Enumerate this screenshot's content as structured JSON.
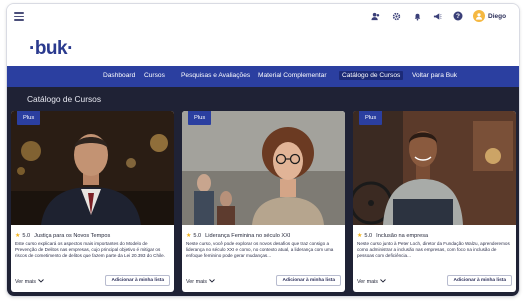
{
  "topbar": {
    "icons": [
      "menu-icon",
      "users-icon",
      "gear-icon",
      "bell-icon",
      "megaphone-icon",
      "help-icon"
    ],
    "user_name": "Diego"
  },
  "logo": {
    "text": "·buk·"
  },
  "nav": {
    "items": [
      {
        "label": "Dashboard",
        "active": false
      },
      {
        "label": "Cursos",
        "active": false
      },
      {
        "label": "Pesquisas e Avaliações",
        "active": false
      },
      {
        "label": "Material Complementar",
        "active": false
      },
      {
        "label": "Catálogo de Cursos",
        "active": true
      },
      {
        "label": "Voltar para Buk",
        "active": false
      }
    ]
  },
  "main": {
    "section_title": "Catálogo de Cursos",
    "cards": [
      {
        "badge": "Plus",
        "rating": "5.0",
        "title": "Justiça para os Novos Tempos",
        "description": "Este curso explicará os aspectos mais importantes do Modelo de Prevenção de Delitos nas empresas, cujo principal objetivo é mitigar os riscos de cometimento de delitos que fazem parte da Lei 20.393 do Chile.",
        "see_more": "Ver mais",
        "add_button": "Adicionar à minha lista"
      },
      {
        "badge": "Plus",
        "rating": "5.0",
        "title": "Liderança Feminina no século XXI",
        "description": "Neste curso, você pode explorar os novos desafios que traz consigo a liderança no século XXI e como, no contexto atual, a liderança com uma enfoque feminino pode gerar mudanças...",
        "see_more": "Ver mais",
        "add_button": "Adicionar à minha lista"
      },
      {
        "badge": "Plus",
        "rating": "5.0",
        "title": "Inclusão na empresa",
        "description": "Neste curso junto à Peter Loch, diretor da Fundação Walzu, aprenderemos como administrar a inclusão nas empresas, com foco na inclusão de pessoas com deficiência...",
        "see_more": "Ver mais",
        "add_button": "Adicionar à minha lista"
      }
    ]
  },
  "colors": {
    "nav_bg": "#2b3fa0",
    "content_bg": "#1f2235",
    "logo": "#2a3a8e",
    "star": "#f2b21b",
    "avatar": "#f5b841"
  }
}
